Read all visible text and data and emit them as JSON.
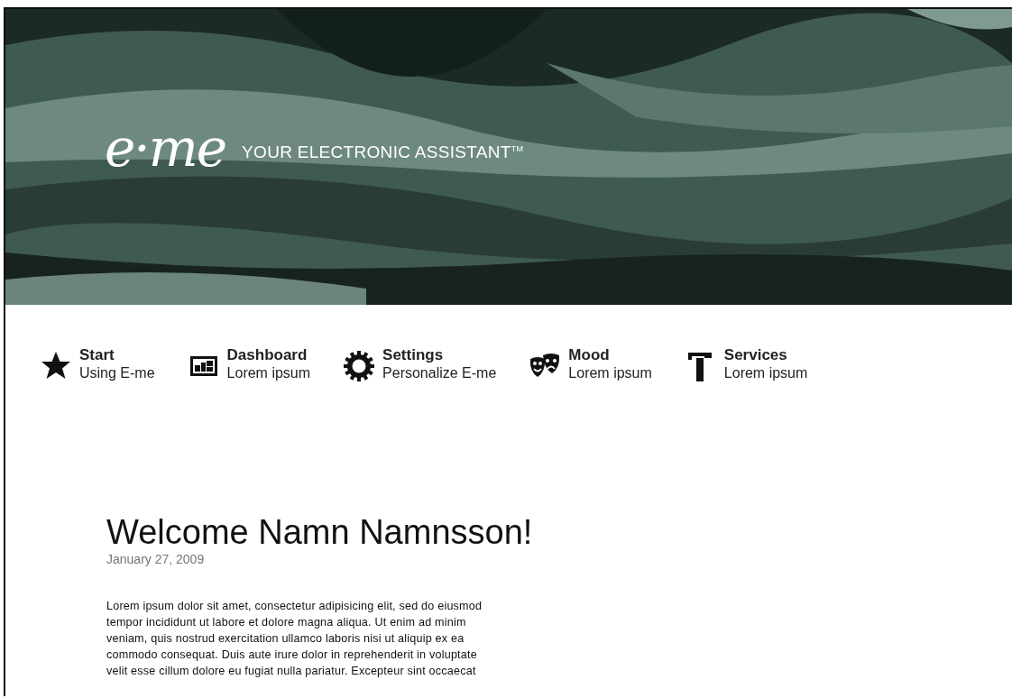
{
  "header": {
    "logo": "e·me",
    "tagline": "YOUR ELECTRONIC ASSISTANT$^{TM}$"
  },
  "nav": [
    {
      "kind": "star",
      "title": "Start",
      "subtitle": "Using E-me"
    },
    {
      "kind": "dashboard",
      "title": "Dashboard",
      "subtitle": "Lorem ipsum"
    },
    {
      "kind": "gear",
      "title": "Settings",
      "subtitle": "Personalize E-me"
    },
    {
      "kind": "masks",
      "title": "Mood",
      "subtitle": "Lorem ipsum"
    },
    {
      "kind": "hammer",
      "title": "Services",
      "subtitle": "Lorem ipsum"
    }
  ],
  "content": {
    "heading": "Welcome Namn Namnsson!",
    "date": "January 27, 2009",
    "body_lines": [
      "Lorem ipsum dolor sit amet, consectetur adipisicing elit, sed do eiusmod",
      "tempor incididunt ut labore et dolore magna aliqua. Ut enim ad minim",
      "veniam, quis nostrud exercitation ullamco laboris nisi ut aliquip ex ea",
      "commodo consequat. Duis aute irure dolor in reprehenderit in voluptate",
      "velit esse cillum dolore eu fugiat nulla pariatur. Excepteur sint occaecat"
    ]
  }
}
